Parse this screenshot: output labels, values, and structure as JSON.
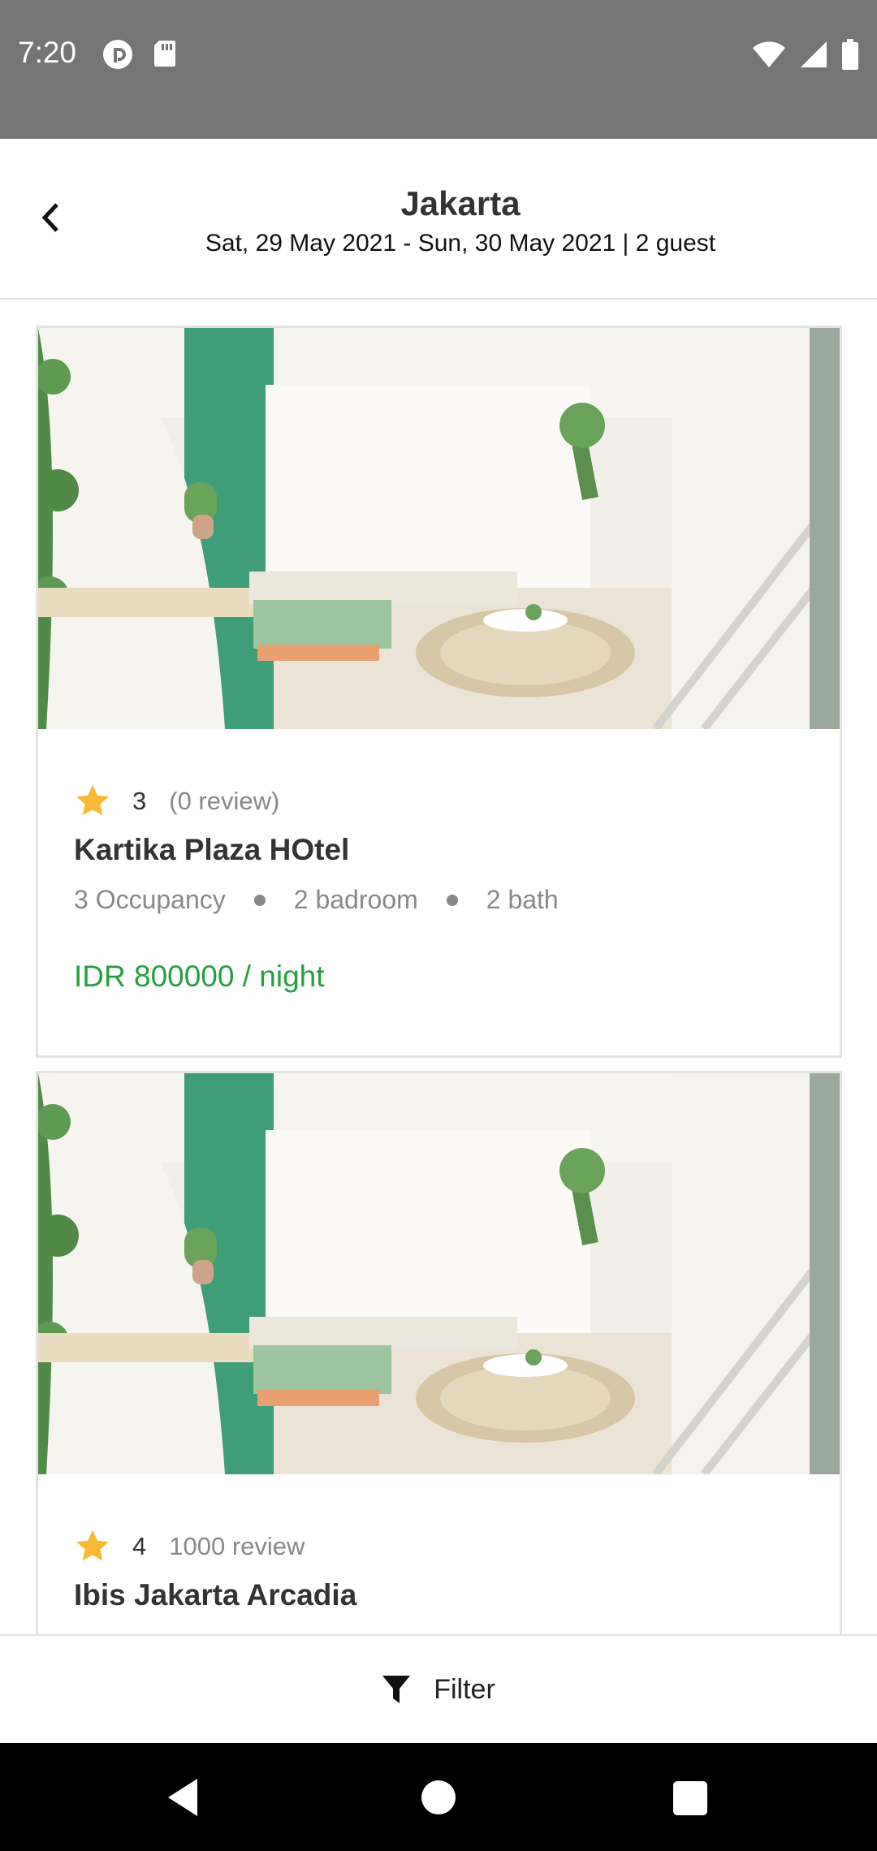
{
  "status_bar": {
    "time": "7:20",
    "left_icons": [
      "pocket-casts-icon",
      "sd-card-icon"
    ],
    "right_icons": [
      "wifi-icon",
      "cellular-signal-icon",
      "battery-icon"
    ]
  },
  "header": {
    "title": "Jakarta",
    "subtitle": "Sat, 29 May 2021 - Sun, 30 May 2021 | 2 guest"
  },
  "hotels": [
    {
      "rating": "3",
      "reviews": "(0 review)",
      "name": "Kartika Plaza HOtel",
      "occupancy": "3 Occupancy",
      "bedrooms": "2 badroom",
      "baths": "2 bath",
      "price": "IDR 800000 / night"
    },
    {
      "rating": "4",
      "reviews": "1000 review",
      "name": "Ibis Jakarta Arcadia"
    }
  ],
  "filter": {
    "label": "Filter"
  },
  "colors": {
    "price_green": "#26a03f",
    "star_yellow": "#f9b935",
    "status_bar_gray": "#757575",
    "accent_green_wall": "#3f9e78"
  }
}
